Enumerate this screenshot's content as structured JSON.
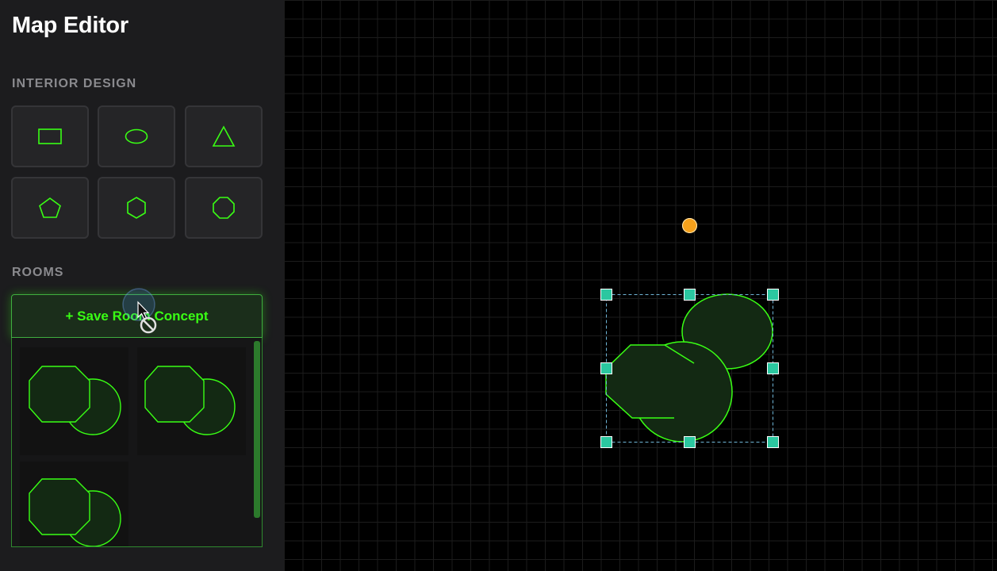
{
  "sidebar": {
    "title": "Map Editor",
    "interior_design_label": "INTERIOR DESIGN",
    "tools": [
      {
        "name": "rectangle-tool",
        "icon": "rectangle-icon"
      },
      {
        "name": "ellipse-tool",
        "icon": "ellipse-icon"
      },
      {
        "name": "triangle-tool",
        "icon": "triangle-icon"
      },
      {
        "name": "pentagon-tool",
        "icon": "pentagon-icon"
      },
      {
        "name": "hexagon-tool",
        "icon": "hexagon-icon"
      },
      {
        "name": "octagon-tool",
        "icon": "octagon-icon"
      }
    ],
    "rooms_label": "ROOMS",
    "save_button_label": "+ Save Room Concept",
    "saved_rooms_count": 3
  },
  "colors": {
    "accent_green": "#39ff14",
    "shape_fill": "#132913",
    "selection_handle": "#2bc7a0",
    "rotate_handle": "#f5a11c",
    "sidebar_bg": "#1c1c1e",
    "canvas_bg": "#000000"
  },
  "cursor": "not-allowed-cursor"
}
